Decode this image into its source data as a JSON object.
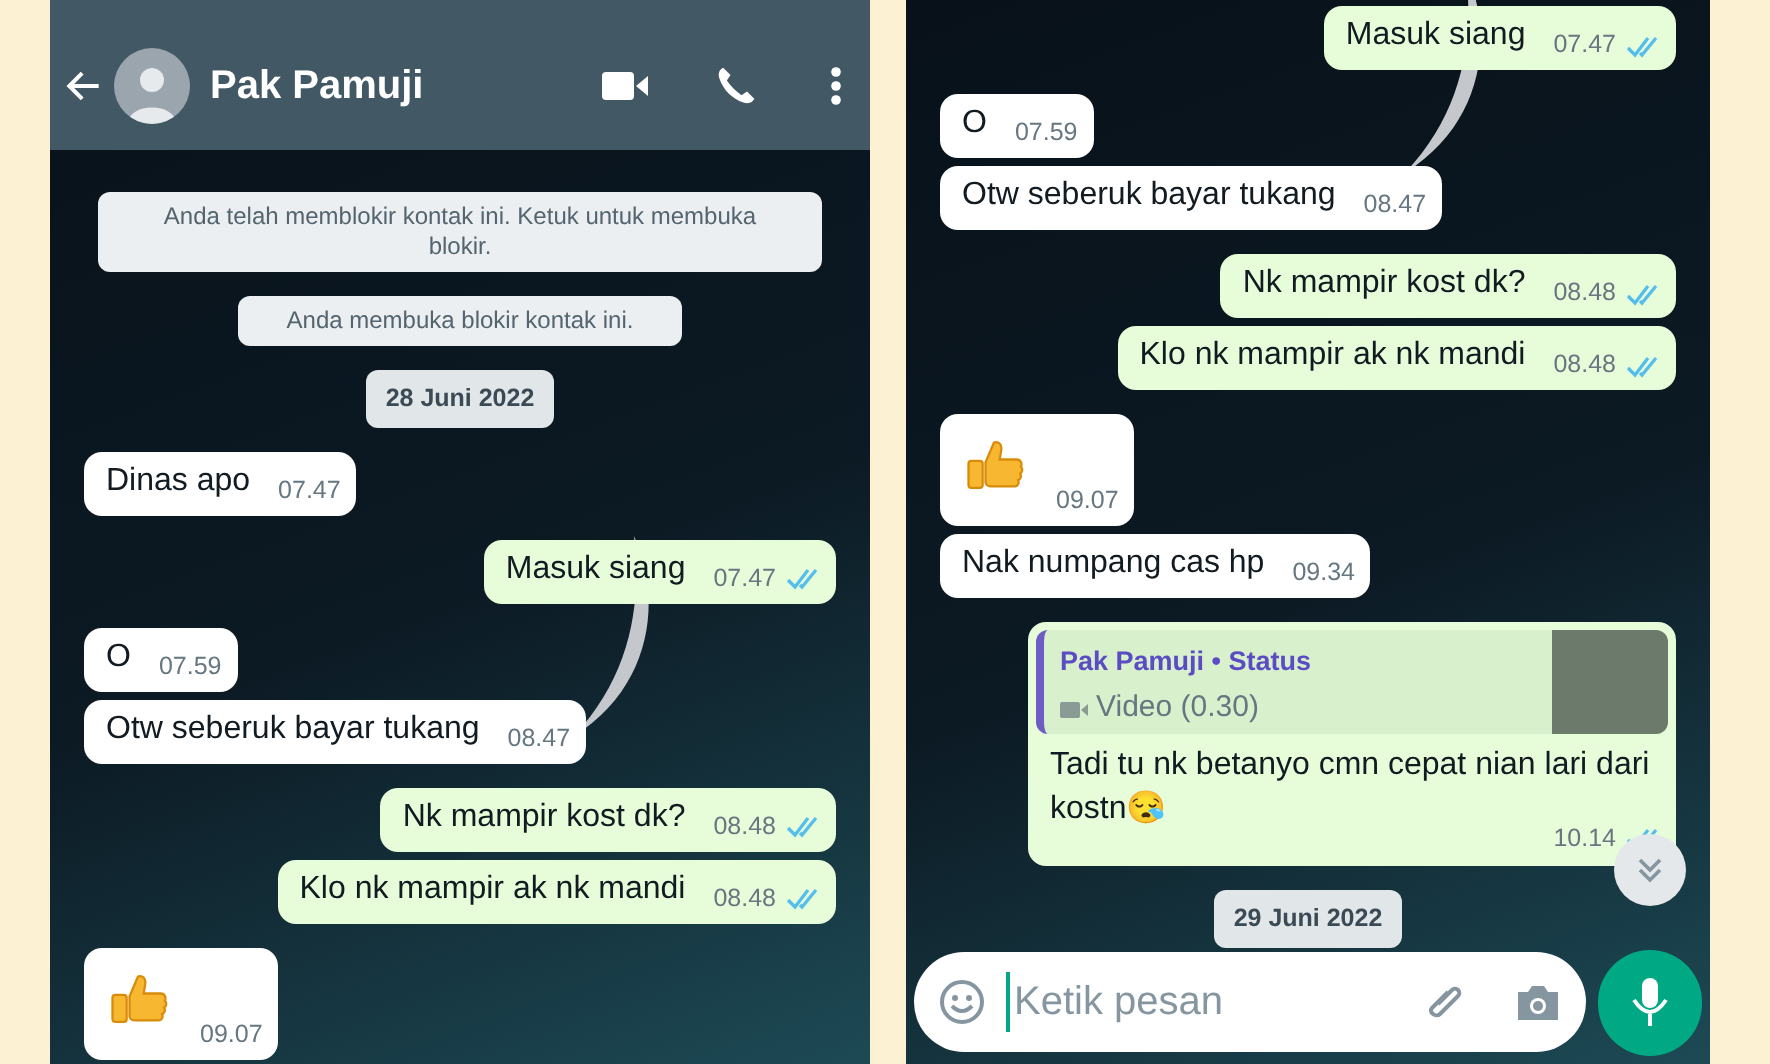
{
  "panels": [
    {
      "header": {
        "contact_name": "Pak Pamuji"
      },
      "messages": [
        {
          "kind": "system",
          "text": "Anda telah memblokir kontak ini. Ketuk untuk membuka blokir."
        },
        {
          "kind": "system",
          "text": "Anda membuka blokir kontak ini."
        },
        {
          "kind": "date",
          "text": "28 Juni 2022"
        },
        {
          "kind": "text",
          "outgoing": false,
          "text": "Dinas apo",
          "time": "07.47"
        },
        {
          "kind": "text",
          "outgoing": true,
          "text": "Masuk siang",
          "time": "07.47",
          "read": true
        },
        {
          "kind": "text",
          "outgoing": false,
          "text": "O",
          "time": "07.59"
        },
        {
          "kind": "text",
          "outgoing": false,
          "text": "Otw seberuk bayar tukang",
          "time": "08.47"
        },
        {
          "kind": "text",
          "outgoing": true,
          "text": "Nk mampir kost dk?",
          "time": "08.48",
          "read": true
        },
        {
          "kind": "text",
          "outgoing": true,
          "text": "Klo nk mampir ak nk mandi",
          "time": "08.48",
          "read": true
        },
        {
          "kind": "emoji",
          "outgoing": false,
          "time": "09.07"
        }
      ]
    },
    {
      "composer": {
        "placeholder": "Ketik pesan"
      },
      "messages": [
        {
          "kind": "text",
          "outgoing": true,
          "text": "Masuk siang",
          "time": "07.47",
          "read": true
        },
        {
          "kind": "text",
          "outgoing": false,
          "text": "O",
          "time": "07.59"
        },
        {
          "kind": "text",
          "outgoing": false,
          "text": "Otw seberuk bayar tukang",
          "time": "08.47"
        },
        {
          "kind": "text",
          "outgoing": true,
          "text": "Nk mampir kost dk?",
          "time": "08.48",
          "read": true
        },
        {
          "kind": "text",
          "outgoing": true,
          "text": "Klo nk mampir ak nk mandi",
          "time": "08.48",
          "read": true
        },
        {
          "kind": "emoji",
          "outgoing": false,
          "time": "09.07"
        },
        {
          "kind": "text",
          "outgoing": false,
          "text": "Nak numpang cas hp",
          "time": "09.34"
        },
        {
          "kind": "reply",
          "outgoing": true,
          "quote_author": "Pak Pamuji • Status",
          "quote_text": "Video (0.30)",
          "text": "Tadi tu nk betanyo cmn cepat nian lari dari kostn😪",
          "time": "10.14",
          "read": true
        },
        {
          "kind": "date",
          "text": "29 Juni 2022"
        }
      ]
    }
  ]
}
